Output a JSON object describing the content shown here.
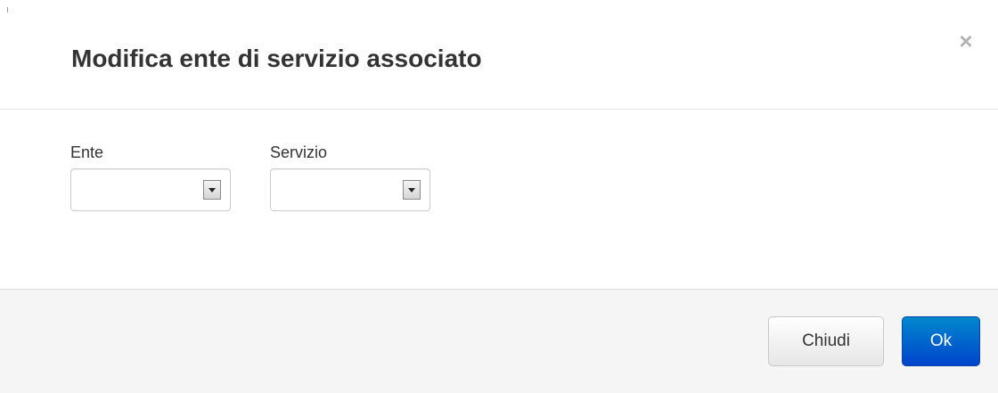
{
  "dialog": {
    "title": "Modifica ente di servizio associato",
    "close_symbol": "×"
  },
  "form": {
    "ente": {
      "label": "Ente",
      "value": ""
    },
    "servizio": {
      "label": "Servizio",
      "value": ""
    }
  },
  "footer": {
    "close_label": "Chiudi",
    "ok_label": "Ok"
  },
  "colors": {
    "primary_button": "#0055cc",
    "footer_background": "#f5f5f5"
  },
  "icons": {
    "close": "close-icon",
    "dropdown": "chevron-down-icon"
  }
}
